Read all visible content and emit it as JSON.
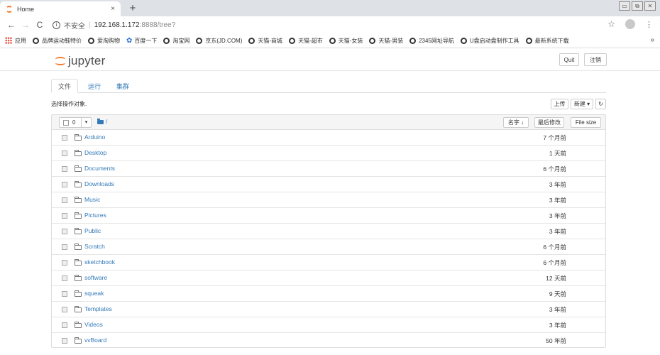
{
  "browser": {
    "tab_title": "Home",
    "tab_close": "×",
    "new_tab": "+",
    "window_controls": [
      "▭",
      "⧉",
      "✕"
    ],
    "nav": {
      "back": "←",
      "forward": "→",
      "reload": "C"
    },
    "address": {
      "info_icon": "i",
      "insecure_label": "不安全",
      "separator": "|",
      "host": "192.168.1.172",
      "path": ":8888/tree?"
    },
    "right_icons": {
      "star": "☆",
      "menu": "⋮"
    }
  },
  "bookmarks": {
    "items": [
      {
        "label": "应用",
        "icon": "apps-icon"
      },
      {
        "label": "品牌运动鞋特价",
        "icon": "globe-icon"
      },
      {
        "label": "爱淘购物",
        "icon": "globe-icon"
      },
      {
        "label": "百度一下",
        "icon": "baidu-icon"
      },
      {
        "label": "淘宝网",
        "icon": "globe-icon"
      },
      {
        "label": "京东(JD.COM)",
        "icon": "globe-icon"
      },
      {
        "label": "天猫-商城",
        "icon": "globe-icon"
      },
      {
        "label": "天猫-超市",
        "icon": "globe-icon"
      },
      {
        "label": "天猫-女装",
        "icon": "globe-icon"
      },
      {
        "label": "天猫-男装",
        "icon": "globe-icon"
      },
      {
        "label": "2345网址导航",
        "icon": "globe-icon"
      },
      {
        "label": "U盘启动盘制作工具",
        "icon": "globe-icon"
      },
      {
        "label": "最新系统下载",
        "icon": "globe-icon"
      }
    ],
    "more": "»"
  },
  "jupyter": {
    "logo_text": "jupyter",
    "quit_label": "Quit",
    "logout_label": "注销",
    "tabs": [
      "文件",
      "运行",
      "集群"
    ],
    "select_hint": "选择操作对象.",
    "upload_label": "上传",
    "new_label": "新建 ▾",
    "refresh_icon": "↻",
    "list_header": {
      "count": "0",
      "dropdown": "▾",
      "breadcrumb": "/",
      "sort_name": "名字 ↓",
      "sort_modified": "最后修改",
      "sort_size": "File size"
    },
    "files": [
      {
        "name": "Arduino",
        "modified": "7 个月前"
      },
      {
        "name": "Desktop",
        "modified": "1 天前"
      },
      {
        "name": "Documents",
        "modified": "6 个月前"
      },
      {
        "name": "Downloads",
        "modified": "3 年前"
      },
      {
        "name": "Music",
        "modified": "3 年前"
      },
      {
        "name": "Pictures",
        "modified": "3 年前"
      },
      {
        "name": "Public",
        "modified": "3 年前"
      },
      {
        "name": "Scratch",
        "modified": "6 个月前"
      },
      {
        "name": "sketchbook",
        "modified": "6 个月前"
      },
      {
        "name": "software",
        "modified": "12 天前"
      },
      {
        "name": "squeak",
        "modified": "9 天前"
      },
      {
        "name": "Templates",
        "modified": "3 年前"
      },
      {
        "name": "Videos",
        "modified": "3 年前"
      },
      {
        "name": "vvBoard",
        "modified": "50 年前"
      }
    ]
  }
}
